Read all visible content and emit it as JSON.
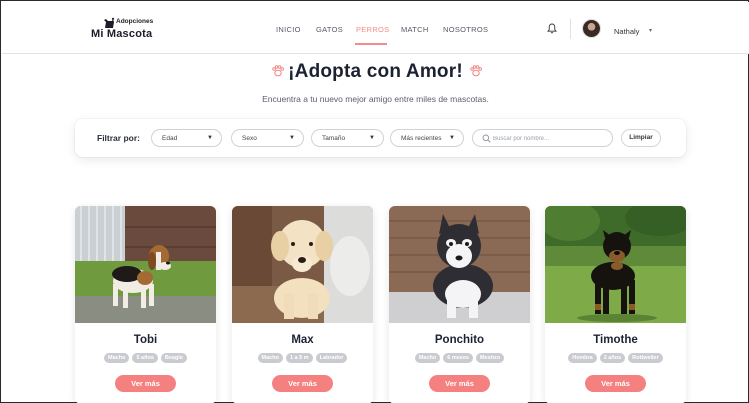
{
  "brand": {
    "line1": "Adopciones",
    "line2": "Mi Mascota",
    "accent": "#f4817f"
  },
  "nav": {
    "items": [
      "INICIO",
      "GATOS",
      "PERROS",
      "MATCH",
      "NOSOTROS"
    ],
    "active": "PERROS"
  },
  "user": {
    "name": "Nathaly",
    "notifications_icon": "bell-icon",
    "menu_icon": "chevron-down-icon"
  },
  "hero": {
    "title": "¡Adopta con Amor!",
    "subtitle": "Encuentra a tu nuevo mejor amigo entre miles de mascotas."
  },
  "filters": {
    "label": "Filtrar por:",
    "age": "Edad",
    "sex": "Sexo",
    "size": "Tamaño",
    "sort": "Más recientes",
    "search_placeholder": "Buscar por nombre...",
    "clear": "Limpiar"
  },
  "pets": [
    {
      "name": "Tobi",
      "sex": "Macho",
      "age": "5 años",
      "breed": "Beagle",
      "button": "Ver más"
    },
    {
      "name": "Max",
      "sex": "Macho",
      "age": "1 a 5 m",
      "breed": "Labrador",
      "button": "Ver más"
    },
    {
      "name": "Ponchito",
      "sex": "Macho",
      "age": "6 meses",
      "breed": "Mestizo",
      "button": "Ver más"
    },
    {
      "name": "Timothe",
      "sex": "Hembra",
      "age": "2 años",
      "breed": "Rottweiler",
      "button": "Ver más"
    }
  ]
}
